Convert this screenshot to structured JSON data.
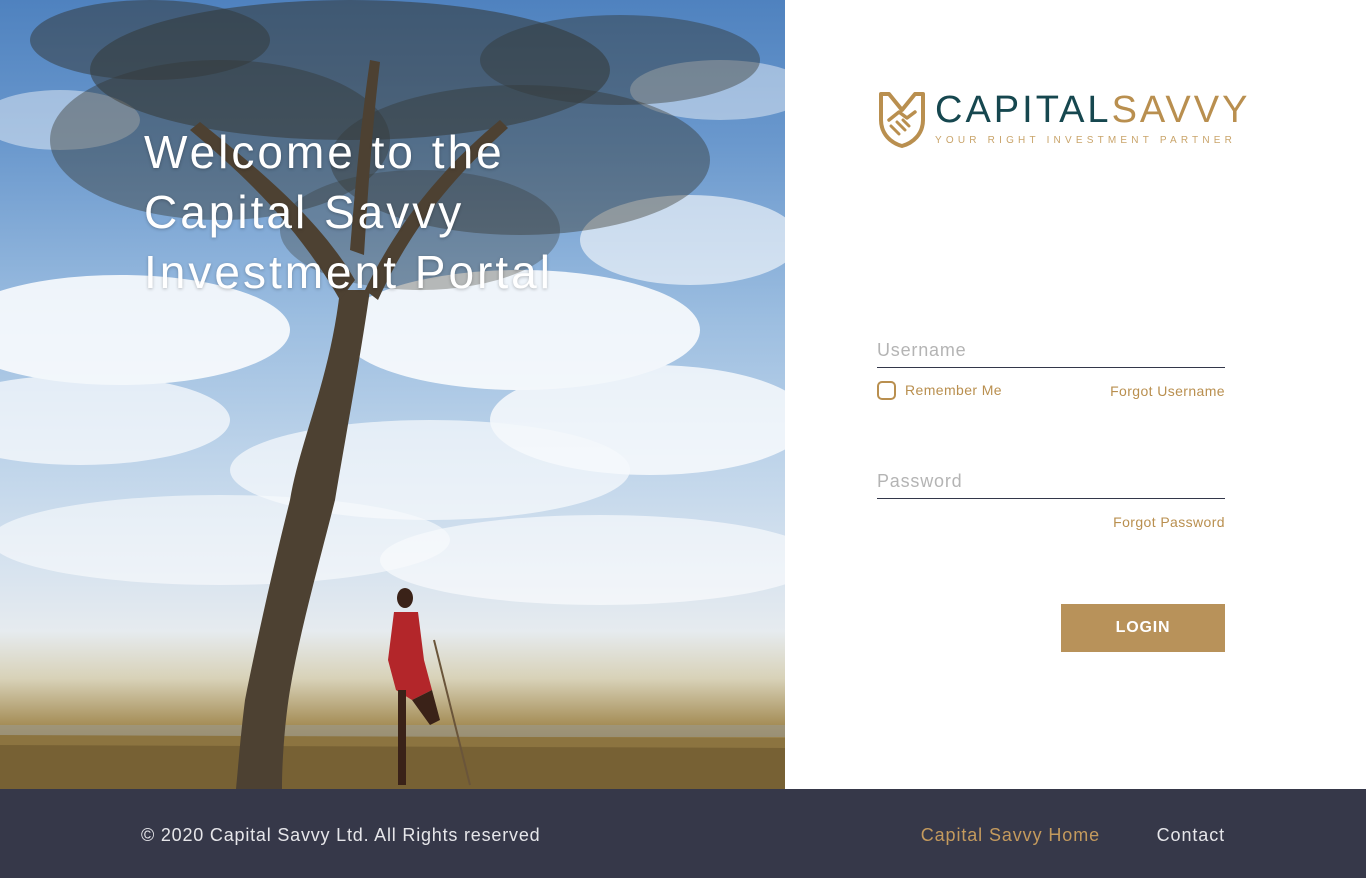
{
  "hero": {
    "title_lines": [
      "Welcome to the",
      "Capital Savvy",
      "Investment Portal"
    ]
  },
  "brand": {
    "name_part1": "CAPITAL",
    "name_part2": "SAVVY",
    "tagline": "YOUR RIGHT INVESTMENT PARTNER",
    "logo_icon": "shield-handshake-icon"
  },
  "login_form": {
    "username_placeholder": "Username",
    "remember_me_label": "Remember Me",
    "remember_me_checked": false,
    "forgot_username_label": "Forgot Username",
    "password_placeholder": "Password",
    "forgot_password_label": "Forgot Password",
    "login_button_label": "LOGIN"
  },
  "footer": {
    "copyright": "© 2020 Capital Savvy Ltd. All Rights reserved",
    "links": [
      {
        "label": "Capital Savvy Home"
      },
      {
        "label": "Contact"
      }
    ]
  },
  "colors": {
    "gold_accent": "#b8925a",
    "teal_brand": "#16474f",
    "footer_bg": "#363849",
    "footer_text": "#e6e6ea"
  }
}
